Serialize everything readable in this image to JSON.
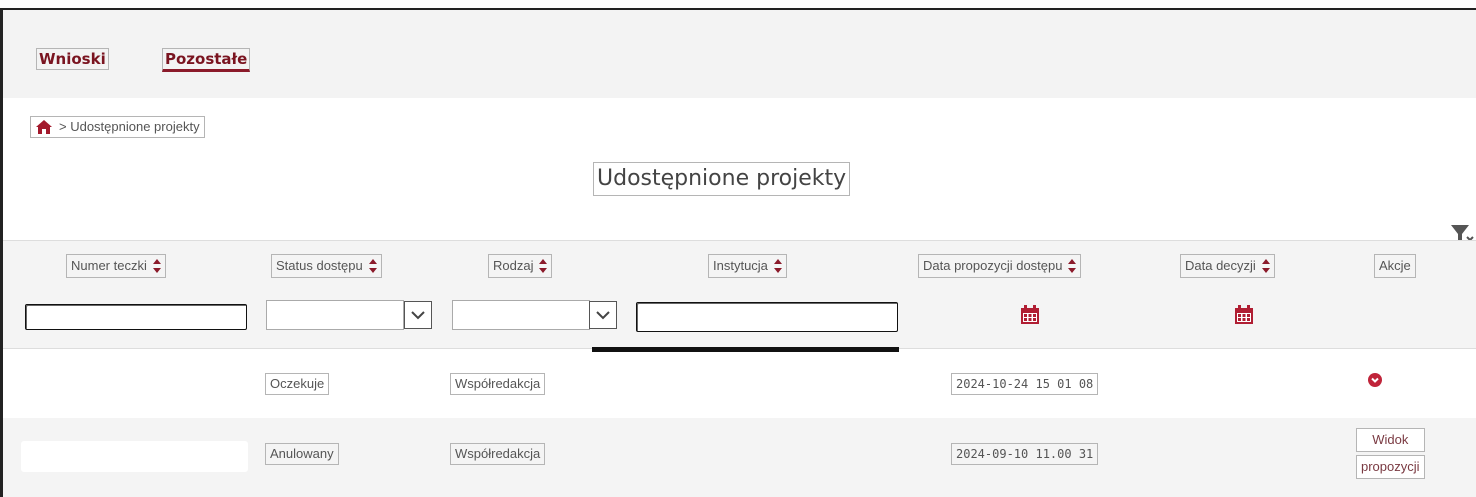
{
  "nav": {
    "items": [
      {
        "label": "Wnioski",
        "active": false
      },
      {
        "label": "Pozostałe",
        "active": true
      }
    ]
  },
  "breadcrumb": {
    "icon": "home-icon",
    "text": "> Udostępnione projekty"
  },
  "page": {
    "title": "Udostępnione projekty",
    "filter_clear_icon": "filter-clear-icon"
  },
  "table": {
    "columns": [
      "Numer teczki",
      "Status dostępu",
      "Rodzaj",
      "Instytucja",
      "Data propozycji dostępu",
      "Data decyzji",
      "Akcje"
    ],
    "filters": {
      "numer_teczki": "",
      "status_dostepu": "",
      "rodzaj": "",
      "instytucja": ""
    },
    "rows": [
      {
        "numer_teczki": "",
        "status": "Oczekuje",
        "rodzaj": "Współredakcja",
        "instytucja": "",
        "data_propozycji": "2024-10-24 15 01 08",
        "data_decyzji": "",
        "akcja_icon": "chevron-circle-down-icon"
      },
      {
        "numer_teczki": "",
        "status": "Anulowany",
        "rodzaj": "Współredakcja",
        "instytucja": "",
        "data_propozycji": "2024-09-10 11.00 31",
        "data_decyzji": "",
        "akcja_line1": "Widok",
        "akcja_line2": "propozycji"
      }
    ]
  },
  "colors": {
    "accent": "#8b1a2a",
    "header_bg": "#f4f4f4",
    "topbar_bg": "#f3f3f3"
  }
}
